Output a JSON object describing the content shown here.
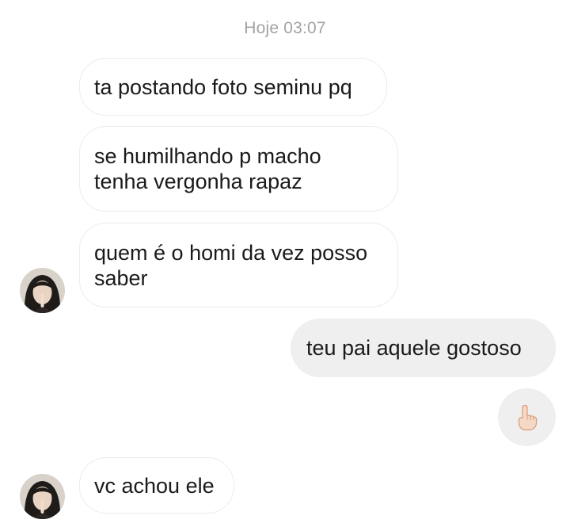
{
  "chat": {
    "timestamp": "Hoje 03:07",
    "messages": [
      {
        "from": "them",
        "lines": [
          "ta postando foto seminu pq"
        ]
      },
      {
        "from": "them",
        "lines": [
          "se humilhando p macho",
          "tenha vergonha rapaz"
        ]
      },
      {
        "from": "them",
        "lines": [
          "quem é o homi da vez posso",
          "saber"
        ]
      },
      {
        "from": "me",
        "lines": [
          "teu pai aquele gostoso"
        ]
      },
      {
        "from": "me",
        "emoji": "middle-finger-icon"
      },
      {
        "from": "them",
        "lines": [
          "vc achou ele"
        ]
      }
    ]
  },
  "colors": {
    "timestamp": "#a3a3a3",
    "incoming_bubble_border": "#ececec",
    "outgoing_bubble_bg": "#efefef",
    "text": "#1a1a1a"
  }
}
